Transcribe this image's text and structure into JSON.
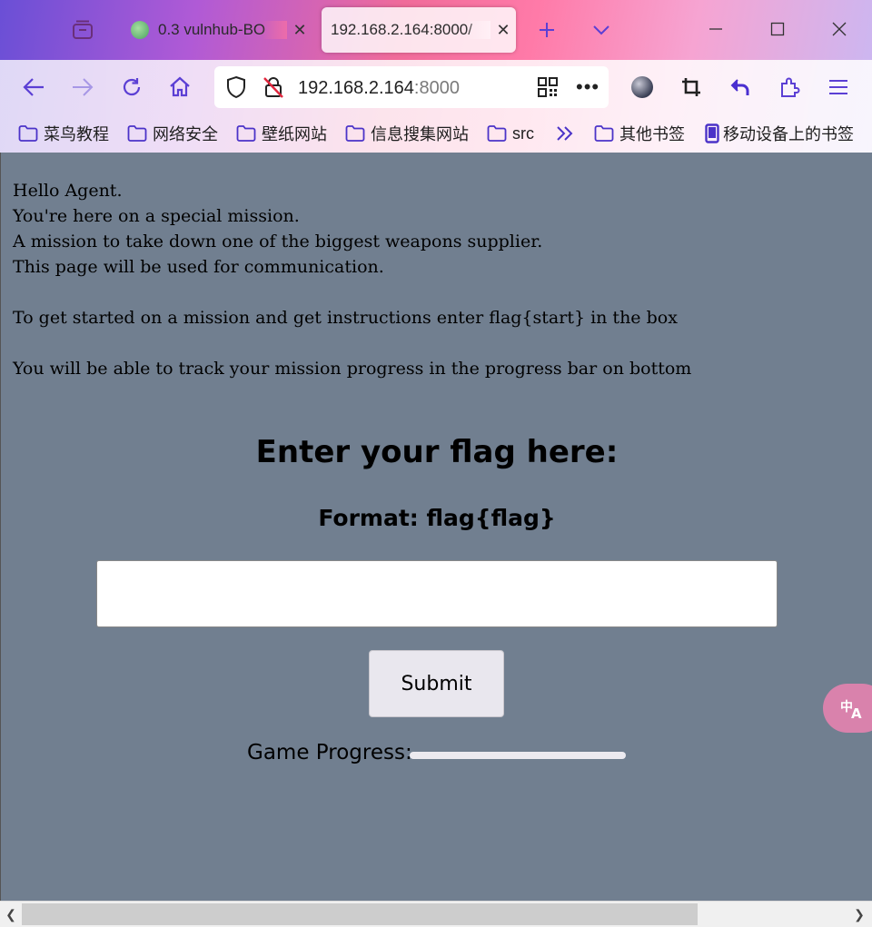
{
  "browser": {
    "tabs": [
      {
        "title": "0.3 vulnhub-BO",
        "active": false
      },
      {
        "title": "192.168.2.164:8000/",
        "active": true
      }
    ],
    "url": {
      "host": "192.168.2.164",
      "port": ":8000"
    },
    "bookmarks": [
      "菜鸟教程",
      "网络安全",
      "壁纸网站",
      "信息搜集网站",
      "src",
      "其他书签",
      "移动设备上的书签"
    ],
    "icons": {
      "tab_overview": "tab-overview-icon",
      "new_tab": "plus-icon",
      "tab_list": "chevron-down-icon",
      "minimize": "minimize-icon",
      "maximize": "maximize-icon",
      "close": "close-icon",
      "back": "back-arrow-icon",
      "forward": "forward-arrow-icon",
      "reload": "reload-icon",
      "home": "home-icon",
      "shield": "shield-icon",
      "insecure": "insecure-lock-icon",
      "qr": "qr-code-icon",
      "more": "more-icon",
      "crop": "crop-icon",
      "undo": "undo-icon",
      "extensions": "extensions-icon",
      "menu": "hamburger-menu-icon",
      "overflow": "double-chevron-icon",
      "folder": "folder-icon",
      "mobile": "mobile-device-icon",
      "translate": "translate-icon"
    },
    "accent": "#5b3fd4"
  },
  "page": {
    "intro": [
      "Hello Agent.",
      "You're here on a special mission.",
      "A mission to take down one of the biggest weapons supplier.",
      "This page will be used for communication.",
      "",
      "To get started on a mission and get instructions enter flag{start} in the box",
      "",
      "You will be able to track your mission progress in the progress bar on bottom"
    ],
    "heading": "Enter your flag here:",
    "subheading": "Format: flag{flag}",
    "flag_input_value": "",
    "submit_label": "Submit",
    "progress_label": "Game Progress:",
    "progress_value": 0
  }
}
